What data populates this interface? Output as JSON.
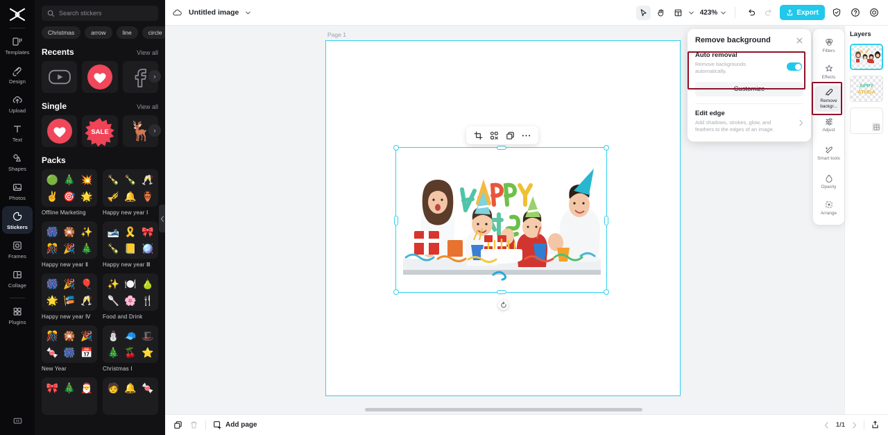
{
  "app": {
    "logo": "capcut-logo"
  },
  "rail": {
    "items": [
      {
        "label": "Templates",
        "icon": "templates-icon",
        "active": false
      },
      {
        "label": "Design",
        "icon": "design-icon",
        "active": false
      },
      {
        "label": "Upload",
        "icon": "upload-icon",
        "active": false
      },
      {
        "label": "Text",
        "icon": "text-icon",
        "active": false
      },
      {
        "label": "Shapes",
        "icon": "shapes-icon",
        "active": false
      },
      {
        "label": "Photos",
        "icon": "photos-icon",
        "active": false
      },
      {
        "label": "Stickers",
        "icon": "stickers-icon",
        "active": true
      },
      {
        "label": "Frames",
        "icon": "frames-icon",
        "active": false
      },
      {
        "label": "Collage",
        "icon": "collage-icon",
        "active": false
      },
      {
        "label": "Plugins",
        "icon": "plugins-icon",
        "active": false
      }
    ],
    "bottom_icon": "panel-toggle-icon"
  },
  "panel": {
    "search": {
      "placeholder": "Search stickers",
      "value": "",
      "icon": "search-icon"
    },
    "chips": [
      "Christmas",
      "arrow",
      "line",
      "circle"
    ],
    "sections": [
      {
        "title": "Recents",
        "view_all": "View all",
        "tiles": [
          "▶",
          "♥",
          "f"
        ]
      },
      {
        "title": "Single",
        "view_all": "View all",
        "tiles": [
          "♥",
          "SALE",
          "🦌"
        ]
      }
    ],
    "packs_title": "Packs",
    "packs": [
      {
        "name": "Offline Marketing",
        "emojis": [
          "🟢",
          "🎄",
          "💥",
          "✌️",
          "🎯",
          "🌟"
        ]
      },
      {
        "name": "Happy new year Ⅰ",
        "emojis": [
          "🍾",
          "🍾",
          "🥂",
          "🎺",
          "🔔",
          "🏺"
        ]
      },
      {
        "name": "Happy new year Ⅱ",
        "emojis": [
          "🎆",
          "🎇",
          "✨",
          "🎊",
          "🎉",
          "🎄"
        ]
      },
      {
        "name": "Happy new year Ⅲ",
        "emojis": [
          "🎿",
          "🎗️",
          "🎀",
          "🍾",
          "📒",
          "🪩"
        ]
      },
      {
        "name": "Happy new year Ⅳ",
        "emojis": [
          "🎆",
          "🎉",
          "🎈",
          "🌟",
          "🎏",
          "🥂"
        ]
      },
      {
        "name": "Food and Drink",
        "emojis": [
          "✨",
          "🍽️",
          "🍐",
          "🥄",
          "🌸",
          "🍴"
        ]
      },
      {
        "name": "New Year",
        "emojis": [
          "🎊",
          "🎇",
          "🎉",
          "🍬",
          "🎆",
          "📅"
        ]
      },
      {
        "name": "Christmas Ⅰ",
        "emojis": [
          "⛄",
          "🧢",
          "🎩",
          "🎄",
          "🍒",
          "⭐"
        ]
      },
      {
        "name": "",
        "emojis": [
          "🎀",
          "🎄",
          "🎅",
          "",
          "",
          ""
        ]
      },
      {
        "name": "",
        "emojis": [
          "🧑",
          "🔔",
          "🍬",
          "",
          "",
          ""
        ]
      }
    ],
    "collapse_icon": "chevron-left-icon"
  },
  "topbar": {
    "cloud_icon": "cloud-icon",
    "doc_title": "Untitled image",
    "title_caret": "chevron-down-icon",
    "tools": [
      {
        "name": "select-tool",
        "icon": "cursor-icon",
        "selected": true
      },
      {
        "name": "hand-tool",
        "icon": "hand-icon",
        "selected": false
      },
      {
        "name": "frame-tool",
        "icon": "frame-icon",
        "selected": false
      }
    ],
    "zoom_level": "423%",
    "zoom_caret": "chevron-down-icon",
    "undo_icon": "undo-icon",
    "redo_icon": "redo-icon",
    "export_label": "Export",
    "export_icon": "export-icon",
    "shield_icon": "shield-icon",
    "help_icon": "help-icon",
    "settings_icon": "settings-icon"
  },
  "canvas": {
    "page_label": "Page 1",
    "page_copy_icon": "duplicate-icon",
    "page_more_icon": "more-icon",
    "object_toolbar": [
      {
        "name": "crop-icon"
      },
      {
        "name": "cutout-icon"
      },
      {
        "name": "duplicate-icon"
      },
      {
        "name": "more-icon"
      }
    ],
    "rotate_icon": "rotate-icon",
    "selected_image": "happy-birthday-family-photo"
  },
  "bottombar": {
    "duplicate_icon": "duplicate-icon",
    "delete_icon": "trash-icon",
    "add_page_label": "Add page",
    "add_page_icon": "add-page-icon",
    "prev_icon": "chevron-left-icon",
    "page_indicator": "1/1",
    "next_icon": "chevron-right-icon",
    "export_icon": "export-icon"
  },
  "remove_bg_panel": {
    "title": "Remove background",
    "close_icon": "close-icon",
    "auto_removal": {
      "title": "Auto removal",
      "subtitle": "Remove backgrounds automatically.",
      "toggle_on": true
    },
    "customize_label": "Customize",
    "edit_edge": {
      "title": "Edit edge",
      "subtitle": "Add shadows, strokes, glow, and feathers to the edges of an image.",
      "chevron": "chevron-right-icon"
    }
  },
  "right_tools": [
    {
      "label": "Filters",
      "icon": "filters-icon",
      "active": false
    },
    {
      "label": "Effects",
      "icon": "effects-icon",
      "active": false
    },
    {
      "label": "Remove backgr...",
      "icon": "remove-background-icon",
      "active": true
    },
    {
      "label": "Adjust",
      "icon": "adjust-icon",
      "active": false
    },
    {
      "label": "Smart tools",
      "icon": "smart-tools-icon",
      "active": false
    },
    {
      "label": "Opacity",
      "icon": "opacity-icon",
      "active": false
    },
    {
      "label": "Arrange",
      "icon": "arrange-icon",
      "active": false
    }
  ],
  "layers": {
    "title": "Layers",
    "items": [
      {
        "name": "layer-photo",
        "selected": true
      },
      {
        "name": "layer-happy-birthday-text",
        "selected": false
      },
      {
        "name": "layer-background",
        "selected": false
      }
    ]
  },
  "colors": {
    "accent": "#22c8ea",
    "selection": "#2fd0ee",
    "highlight": "#8e1127",
    "rail_bg": "#0a0a0c",
    "panel_bg": "#121214"
  }
}
